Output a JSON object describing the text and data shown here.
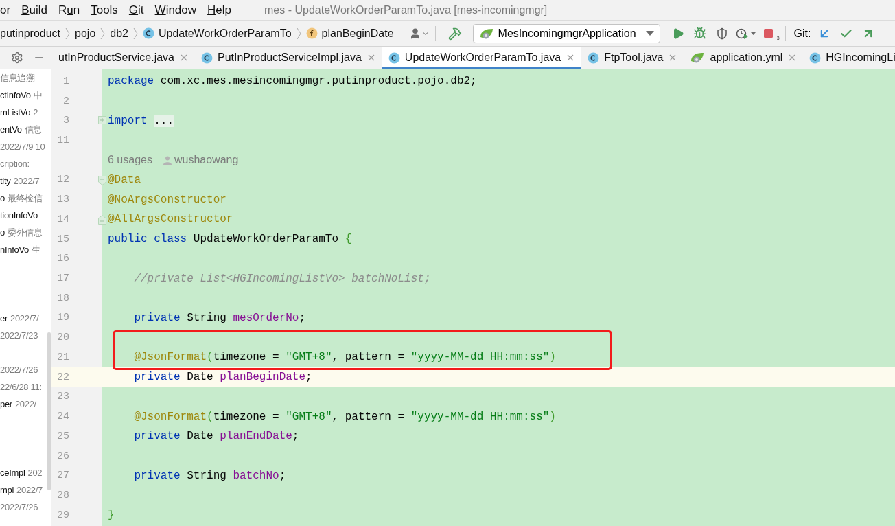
{
  "menu": [
    {
      "lead": "o",
      "rest": "r"
    },
    {
      "key": "B",
      "rest": "uild"
    },
    {
      "lead": "R",
      "key": "u",
      "rest": "n"
    },
    {
      "key": "T",
      "rest": "ools"
    },
    {
      "key": "G",
      "rest": "it"
    },
    {
      "key": "W",
      "rest": "indow"
    },
    {
      "key": "H",
      "rest": "elp"
    }
  ],
  "window": {
    "title": "mes - UpdateWorkOrderParamTo.java [mes-incomingmgr]"
  },
  "breadcrumbs": [
    {
      "kind": "package",
      "label": "putinproduct"
    },
    {
      "kind": "package",
      "label": "pojo"
    },
    {
      "kind": "package",
      "label": "db2"
    },
    {
      "kind": "class",
      "label": "UpdateWorkOrderParamTo"
    },
    {
      "kind": "field",
      "label": "planBeginDate"
    }
  ],
  "run_config": {
    "label": "MesIncomingmgrApplication"
  },
  "stop_badge": "3",
  "git": {
    "label": "Git:"
  },
  "sidebar": {
    "items": [
      {
        "kind": "entry",
        "detail": "信息追溯"
      },
      {
        "kind": "entry",
        "name": "ctInfoVo",
        "detail": "中"
      },
      {
        "kind": "entry",
        "name": "mListVo",
        "detail": "2"
      },
      {
        "kind": "entry",
        "name": "entVo",
        "detail": "信息"
      },
      {
        "kind": "entry",
        "detail": "2022/7/9 10"
      },
      {
        "kind": "entry",
        "detail": "cription:"
      },
      {
        "kind": "entry",
        "name": "tity",
        "detail": "2022/7"
      },
      {
        "kind": "entry",
        "name": "o",
        "detail": "最终检信"
      },
      {
        "kind": "entry",
        "name": "tionInfoVo"
      },
      {
        "kind": "entry",
        "name": "o",
        "detail": "委外信息"
      },
      {
        "kind": "entry",
        "name": "nInfoVo",
        "detail": "生"
      },
      {
        "kind": "offscreen"
      },
      {
        "kind": "offscreen"
      },
      {
        "kind": "offscreen"
      },
      {
        "kind": "entry",
        "name": "er",
        "detail": "2022/7/"
      },
      {
        "kind": "entry",
        "detail": "2022/7/23"
      },
      {
        "kind": "offscreen"
      },
      {
        "kind": "entry",
        "detail": "2022/7/26"
      },
      {
        "kind": "entry",
        "detail": "22/6/28 11:"
      },
      {
        "kind": "entry",
        "name": "per",
        "detail": "2022/"
      },
      {
        "kind": "offscreen"
      },
      {
        "kind": "offscreen"
      },
      {
        "kind": "offscreen"
      },
      {
        "kind": "entry",
        "name": "ceImpl",
        "detail": "202"
      },
      {
        "kind": "entry",
        "name": "mpl",
        "detail": "2022/7"
      },
      {
        "kind": "entry",
        "detail": "2022/7/26"
      }
    ]
  },
  "tabs": [
    {
      "kind": "cut-off",
      "label": "utInProductService.java",
      "selected": false,
      "closable": true
    },
    {
      "kind": "class",
      "label": "PutInProductServiceImpl.java",
      "selected": false,
      "closable": true
    },
    {
      "kind": "class",
      "label": "UpdateWorkOrderParamTo.java",
      "selected": true,
      "closable": true
    },
    {
      "kind": "class",
      "label": "FtpTool.java",
      "selected": false,
      "closable": true
    },
    {
      "kind": "spring-config",
      "label": "application.yml",
      "selected": false,
      "closable": true
    },
    {
      "kind": "class",
      "label": "HGIncomingLi",
      "selected": false,
      "closable": false
    }
  ],
  "lines": [
    {
      "kind": "code",
      "number": "1",
      "current": false,
      "tokens": [
        {
          "kind": "keyword",
          "text": "package"
        },
        {
          "kind": "plain",
          "text": " com.xc.mes.mesincomingmgr.putinproduct.pojo.db2;"
        }
      ]
    },
    {
      "kind": "code",
      "number": "2",
      "current": false
    },
    {
      "kind": "fold-collapsed",
      "number": "3",
      "current": false,
      "tokens": [
        {
          "kind": "keyword",
          "text": "import "
        },
        {
          "kind": "folded",
          "text": "..."
        }
      ]
    },
    {
      "kind": "code",
      "number": "11",
      "current": false
    },
    {
      "kind": "hint",
      "usages": "6 usages",
      "author": "wushaowang"
    },
    {
      "kind": "fold-start",
      "number": "12",
      "current": false,
      "tokens": [
        {
          "kind": "annotation",
          "text": "@Data"
        }
      ]
    },
    {
      "kind": "code",
      "number": "13",
      "current": false,
      "tokens": [
        {
          "kind": "annotation",
          "text": "@NoArgsConstructor"
        }
      ]
    },
    {
      "kind": "fold-end",
      "number": "14",
      "current": false,
      "tokens": [
        {
          "kind": "annotation",
          "text": "@AllArgsConstructor"
        }
      ]
    },
    {
      "kind": "code",
      "number": "15",
      "current": false,
      "tokens": [
        {
          "kind": "keyword",
          "text": "public class"
        },
        {
          "kind": "plain",
          "text": " UpdateWorkOrderParamTo "
        },
        {
          "kind": "bracket",
          "text": "{"
        }
      ]
    },
    {
      "kind": "code",
      "number": "16",
      "current": false
    },
    {
      "kind": "code",
      "number": "17",
      "current": false,
      "tokens": [
        {
          "kind": "comment",
          "text": "    //private List<HGIncomingListVo> batchNoList;"
        }
      ]
    },
    {
      "kind": "code",
      "number": "18",
      "current": false
    },
    {
      "kind": "code",
      "number": "19",
      "current": false,
      "tokens": [
        {
          "kind": "keyword",
          "text": "    private"
        },
        {
          "kind": "plain",
          "text": " String "
        },
        {
          "kind": "field",
          "text": "mesOrderNo"
        },
        {
          "kind": "plain",
          "text": ";"
        }
      ]
    },
    {
      "kind": "highlight",
      "lines": [
        {
          "kind": "code",
          "number": "20",
          "current": false
        },
        {
          "kind": "code",
          "number": "21",
          "current": false,
          "tokens": [
            {
              "kind": "annotation",
              "text": "    @JsonFormat"
            },
            {
              "kind": "bracket",
              "text": "("
            },
            {
              "kind": "plain",
              "text": "timezone = "
            },
            {
              "kind": "string",
              "text": "\"GMT+8\""
            },
            {
              "kind": "plain",
              "text": ", pattern = "
            },
            {
              "kind": "string",
              "text": "\"yyyy-MM-dd HH:mm:ss\""
            },
            {
              "kind": "bracket",
              "text": ")"
            }
          ]
        }
      ]
    },
    {
      "kind": "code",
      "number": "22",
      "current": true,
      "tokens": [
        {
          "kind": "keyword",
          "text": "    private"
        },
        {
          "kind": "plain",
          "text": " Date "
        },
        {
          "kind": "field",
          "text": "planBeginDate"
        },
        {
          "kind": "plain",
          "text": ";"
        }
      ]
    },
    {
      "kind": "code",
      "number": "23",
      "current": false
    },
    {
      "kind": "code",
      "number": "24",
      "current": false,
      "tokens": [
        {
          "kind": "annotation",
          "text": "    @JsonFormat"
        },
        {
          "kind": "bracket",
          "text": "("
        },
        {
          "kind": "plain",
          "text": "timezone = "
        },
        {
          "kind": "string",
          "text": "\"GMT+8\""
        },
        {
          "kind": "plain",
          "text": ", pattern = "
        },
        {
          "kind": "string",
          "text": "\"yyyy-MM-dd HH:mm:ss\""
        },
        {
          "kind": "bracket",
          "text": ")"
        }
      ]
    },
    {
      "kind": "code",
      "number": "25",
      "current": false,
      "tokens": [
        {
          "kind": "keyword",
          "text": "    private"
        },
        {
          "kind": "plain",
          "text": " Date "
        },
        {
          "kind": "field",
          "text": "planEndDate"
        },
        {
          "kind": "plain",
          "text": ";"
        }
      ]
    },
    {
      "kind": "code",
      "number": "26",
      "current": false
    },
    {
      "kind": "code",
      "number": "27",
      "current": false,
      "tokens": [
        {
          "kind": "keyword",
          "text": "    private"
        },
        {
          "kind": "plain",
          "text": " String "
        },
        {
          "kind": "field",
          "text": "batchNo"
        },
        {
          "kind": "plain",
          "text": ";"
        }
      ]
    },
    {
      "kind": "code",
      "number": "28",
      "current": false
    },
    {
      "kind": "code",
      "number": "29",
      "current": false,
      "tokens": [
        {
          "kind": "bracket",
          "text": "}"
        }
      ]
    }
  ]
}
